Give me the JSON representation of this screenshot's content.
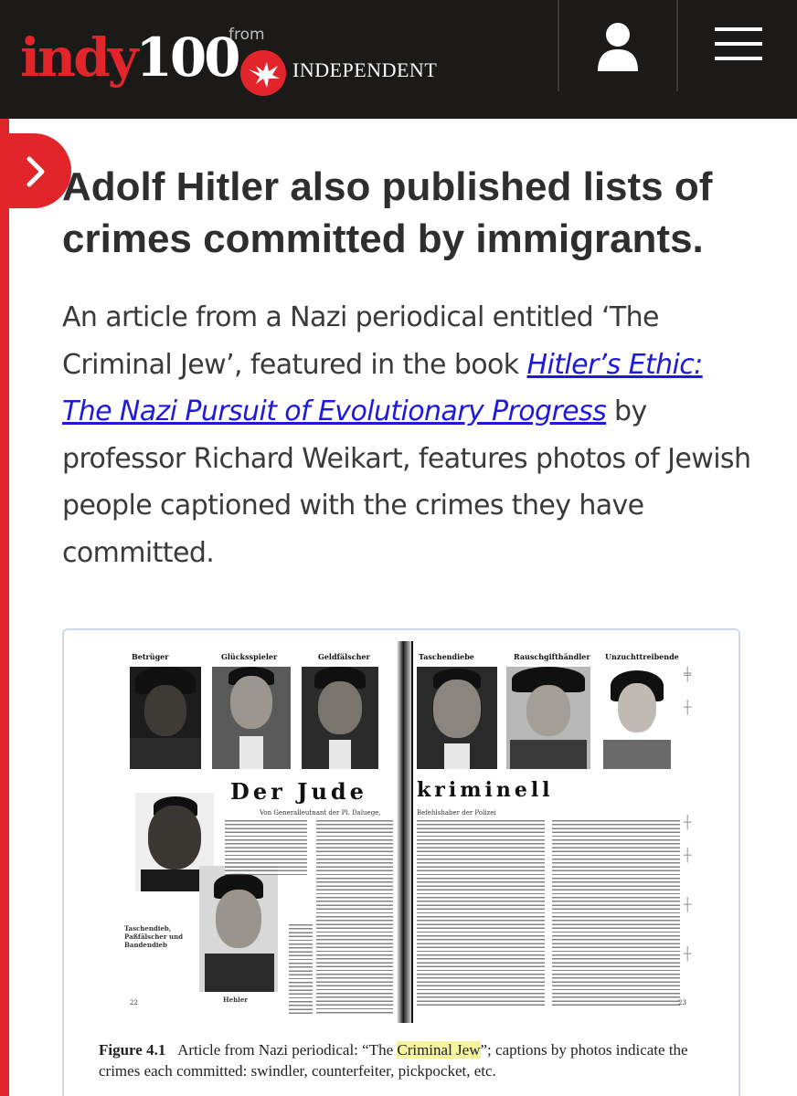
{
  "header": {
    "logo_indy": "indy",
    "logo_number": "100",
    "logo_from": "from",
    "logo_independent": "INDEPENDENT",
    "background": "#1b1a19",
    "accent": "#e2242b",
    "user_icon": "user-icon",
    "menu_icon": "hamburger-menu-icon"
  },
  "side_tab": {
    "icon": "chevron-right-icon"
  },
  "article": {
    "headline": "Adolf Hitler also published lists of crimes committed by immigrants.",
    "paragraph_before": "An article from a Nazi periodical entitled ‘The Criminal Jew’, featured in the book ",
    "link_text": "Hitler’s Ethic: The Nazi Pursuit of Evolutionary Progress",
    "paragraph_after": " by professor Richard Weikart, features photos of Jewish people captioned with the crimes they have committed.",
    "link_color": "#1d1adb"
  },
  "figure": {
    "scan_left_captions": [
      "Betrüger",
      "Glücksspieler",
      "Geldfälscher"
    ],
    "scan_right_captions": [
      "Taschendiebe",
      "Rauschgifthändler",
      "Unzuchttreibende"
    ],
    "scan_title_left": "Der Jude",
    "scan_title_right": "kriminell",
    "scan_subline_left": "Von Generalleutnant der Pl. Daluege,",
    "scan_subline_right": "Befehlshaber der Polizei",
    "scan_side_caption_1": "Taschendieb, Paßfälscher und Bandendieb",
    "scan_side_caption_2": "Hehler",
    "page_num_left": "22",
    "page_num_right": "23",
    "caption_label": "Figure 4.1",
    "caption_before": "Article from Nazi periodical: “The ",
    "caption_highlight": "Criminal Jew",
    "caption_after": "”; captions by photos indicate the crimes each committed: swindler, counterfeiter, pickpocket, etc.",
    "highlight_color": "#f6f3a0"
  }
}
